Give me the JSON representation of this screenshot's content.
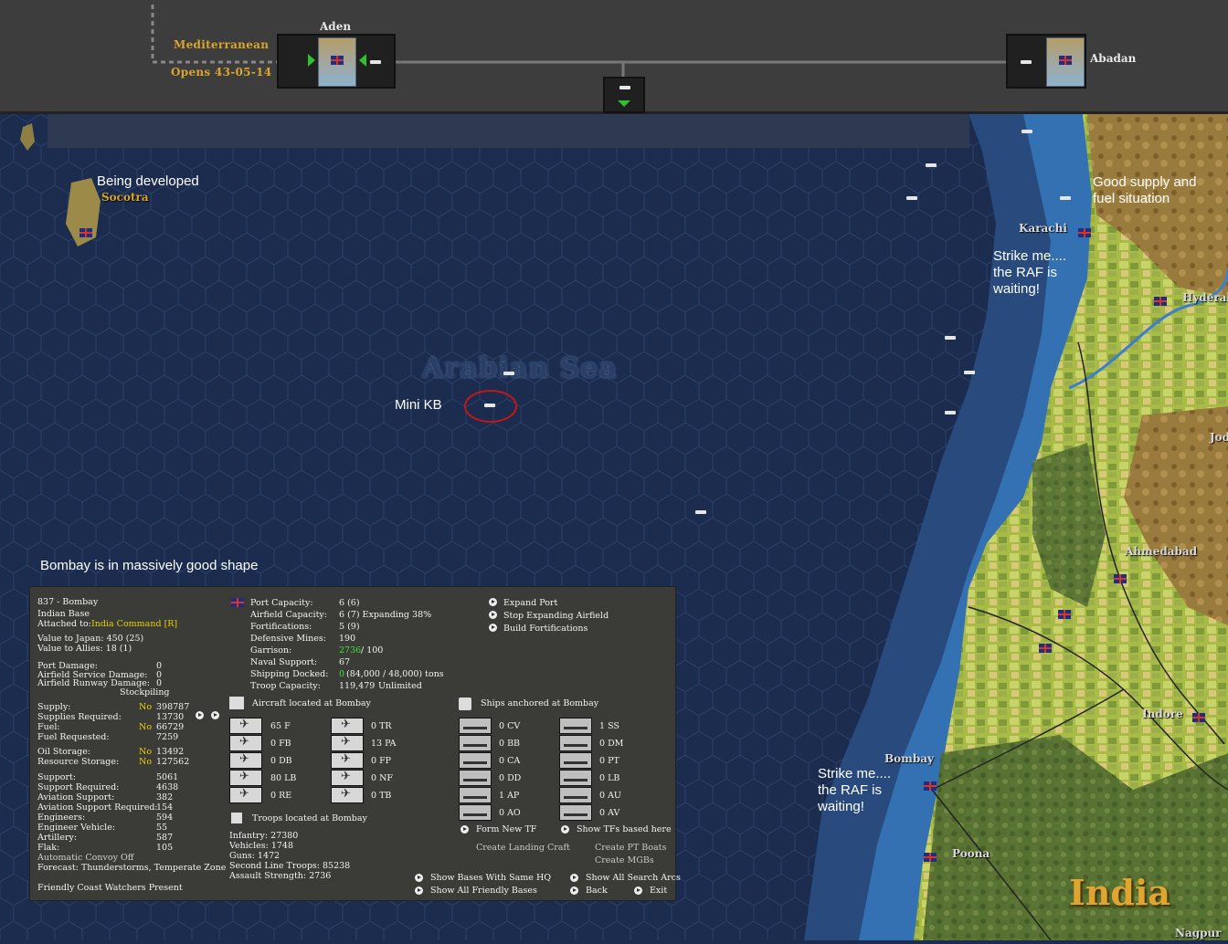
{
  "top_bar": {
    "mediterranean": "Mediterranean",
    "opens": "Opens 43-05-14",
    "aden": "Aden",
    "abadan": "Abadan"
  },
  "annotations": {
    "socotra_dev": "Being developed",
    "supply": "Good supply and fuel situation",
    "raf1": "Strike me.... the RAF is waiting!",
    "raf2": "Strike me.... the RAF is waiting!",
    "mini_kb": "Mini KB",
    "bombay_shape": "Bombay is in massively good shape"
  },
  "map_labels": {
    "socotra": "Socotra",
    "karachi": "Karachi",
    "hyderabad": "Hyderab",
    "jod": "Jod",
    "arabian_sea": "Arabian Sea",
    "ahmedabad": "Ahmedabad",
    "indore": "Indore",
    "bombay": "Bombay",
    "poona": "Poona",
    "india": "India",
    "nagpur": "Nagpur"
  },
  "colors": {
    "sea_deep": "#1b2c4f",
    "sea_shallow": "#2f5d94",
    "coast": "#3c7cc0",
    "land_green": "#a7b83d",
    "land_brown": "#8b6a33",
    "accent_gold": "#d9a52b"
  },
  "base_panel": {
    "id_name": "837 - Bombay",
    "type": "Indian Base",
    "attached_label": "Attached to:",
    "attached_value": "India Command [R]",
    "value_japan": "Value to Japan: 450 (25)",
    "value_allies": "Value to Allies: 18 (1)",
    "port_damage_label": "Port Damage:",
    "port_damage": "0",
    "af_service_label": "Airfield Service Damage:",
    "af_service": "0",
    "af_runway_label": "Airfield Runway Damage:",
    "af_runway": "0",
    "stockpiling": "Stockpiling",
    "supply_label": "Supply:",
    "supply_no": "No",
    "supply": "398787",
    "supplies_req_label": "Supplies Required:",
    "supplies_req": "13730",
    "fuel_label": "Fuel:",
    "fuel_no": "No",
    "fuel": "66729",
    "fuel_req_label": "Fuel Requested:",
    "fuel_req": "7259",
    "oil_label": "Oil Storage:",
    "oil_no": "No",
    "oil": "13492",
    "res_label": "Resource Storage:",
    "res_no": "No",
    "res": "127562",
    "support_label": "Support:",
    "support": "5061",
    "support_req_label": "Support Required:",
    "support_req": "4638",
    "av_support_label": "Aviation Support:",
    "av_support": "382",
    "av_support_req_label": "Aviation Support Required:",
    "av_support_req": "154",
    "engineers_label": "Engineers:",
    "engineers": "594",
    "eng_vehicle_label": "Engineer Vehicle:",
    "eng_vehicle": "55",
    "artillery_label": "Artillery:",
    "artillery": "587",
    "flak_label": "Flak:",
    "flak": "105",
    "convoy": "Automatic Convoy Off",
    "forecast": "Forecast: Thunderstorms, Temperate Zone",
    "coast_watchers": "Friendly Coast Watchers Present",
    "port_cap_label": "Port Capacity:",
    "port_cap": "6 (6)",
    "af_cap_label": "Airfield Capacity:",
    "af_cap": "6 (7) Expanding 38%",
    "forts_label": "Fortifications:",
    "forts": "5 (9)",
    "mines_label": "Defensive Mines:",
    "mines": "190",
    "garrison_label": "Garrison:",
    "garrison_val": "2736",
    "garrison_req": "/ 100",
    "naval_label": "Naval Support:",
    "naval": "67",
    "shipping_label": "Shipping Docked:",
    "shipping_val": "0",
    "shipping_rest": "(84,000 / 48,000) tons",
    "troop_cap_label": "Troop Capacity:",
    "troop_cap": "119,479",
    "troop_cap2": "Unlimited",
    "expand_port": "Expand Port",
    "stop_expanding": "Stop Expanding Airfield",
    "build_forts": "Build Fortifications",
    "aircraft_header": "Aircraft located at Bombay",
    "ships_header": "Ships anchored at Bombay",
    "aircraft": [
      "65 F",
      "0 FB",
      "0 DB",
      "80 LB",
      "0 RE",
      "0 TR",
      "13 PA",
      "0 FP",
      "0 NF",
      "0 TB"
    ],
    "ships": [
      "0 CV",
      "0 BB",
      "0 CA",
      "0 DD",
      "1 AP",
      "0 AO",
      "1 SS",
      "0 DM",
      "0 PT",
      "0 LB",
      "0 AU",
      "0 AV"
    ],
    "form_tf": "Form New TF",
    "show_tfs": "Show TFs based here",
    "landing_craft": "Create Landing Craft",
    "pt_boats": "Create PT Boats",
    "mgbs": "Create MGBs",
    "troops_header": "Troops located at Bombay",
    "infantry": "Infantry: 27380",
    "vehicles": "Vehicles: 1748",
    "guns": "Guns: 1472",
    "second_line": "Second Line Troops: 85238",
    "assault": "Assault Strength: 2736",
    "show_bases_hq": "Show Bases With Same HQ",
    "show_search_arcs": "Show All Search Arcs",
    "show_friendly": "Show All Friendly Bases",
    "back": "Back",
    "exit": "Exit"
  }
}
